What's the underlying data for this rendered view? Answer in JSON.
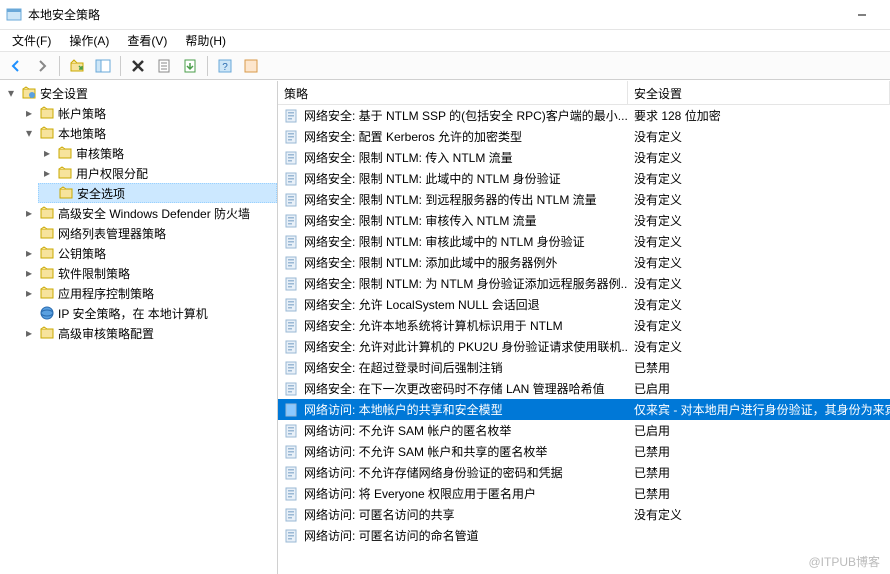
{
  "window": {
    "title": "本地安全策略"
  },
  "menu": {
    "file": "文件(F)",
    "action": "操作(A)",
    "view": "查看(V)",
    "help": "帮助(H)"
  },
  "tree": {
    "root": "安全设置",
    "account": "帐户策略",
    "local": "本地策略",
    "audit": "审核策略",
    "rights": "用户权限分配",
    "options": "安全选项",
    "defender": "高级安全 Windows Defender 防火墙",
    "netlist": "网络列表管理器策略",
    "pubkey": "公钥策略",
    "software": "软件限制策略",
    "appctrl": "应用程序控制策略",
    "ipsec": "IP 安全策略，在 本地计算机",
    "advaudit": "高级审核策略配置"
  },
  "columns": {
    "policy": "策略",
    "setting": "安全设置"
  },
  "policies": [
    {
      "name": "网络安全: 基于 NTLM SSP 的(包括安全 RPC)客户端的最小...",
      "setting": "要求 128 位加密"
    },
    {
      "name": "网络安全: 配置 Kerberos 允许的加密类型",
      "setting": "没有定义"
    },
    {
      "name": "网络安全: 限制 NTLM: 传入 NTLM 流量",
      "setting": "没有定义"
    },
    {
      "name": "网络安全: 限制 NTLM: 此域中的 NTLM 身份验证",
      "setting": "没有定义"
    },
    {
      "name": "网络安全: 限制 NTLM: 到远程服务器的传出 NTLM 流量",
      "setting": "没有定义"
    },
    {
      "name": "网络安全: 限制 NTLM: 审核传入 NTLM 流量",
      "setting": "没有定义"
    },
    {
      "name": "网络安全: 限制 NTLM: 审核此域中的 NTLM 身份验证",
      "setting": "没有定义"
    },
    {
      "name": "网络安全: 限制 NTLM: 添加此域中的服务器例外",
      "setting": "没有定义"
    },
    {
      "name": "网络安全: 限制 NTLM: 为 NTLM 身份验证添加远程服务器例...",
      "setting": "没有定义"
    },
    {
      "name": "网络安全: 允许 LocalSystem NULL 会话回退",
      "setting": "没有定义"
    },
    {
      "name": "网络安全: 允许本地系统将计算机标识用于 NTLM",
      "setting": "没有定义"
    },
    {
      "name": "网络安全: 允许对此计算机的 PKU2U 身份验证请求使用联机...",
      "setting": "没有定义"
    },
    {
      "name": "网络安全: 在超过登录时间后强制注销",
      "setting": "已禁用"
    },
    {
      "name": "网络安全: 在下一次更改密码时不存储 LAN 管理器哈希值",
      "setting": "已启用"
    },
    {
      "name": "网络访问: 本地帐户的共享和安全模型",
      "setting": "仅来宾 - 对本地用户进行身份验证，其身份为来宾",
      "selected": true
    },
    {
      "name": "网络访问: 不允许 SAM 帐户的匿名枚举",
      "setting": "已启用"
    },
    {
      "name": "网络访问: 不允许 SAM 帐户和共享的匿名枚举",
      "setting": "已禁用"
    },
    {
      "name": "网络访问: 不允许存储网络身份验证的密码和凭据",
      "setting": "已禁用"
    },
    {
      "name": "网络访问: 将 Everyone 权限应用于匿名用户",
      "setting": "已禁用"
    },
    {
      "name": "网络访问: 可匿名访问的共享",
      "setting": "没有定义"
    },
    {
      "name": "网络访问: 可匿名访问的命名管道",
      "setting": ""
    }
  ],
  "watermark": "@ITPUB博客"
}
